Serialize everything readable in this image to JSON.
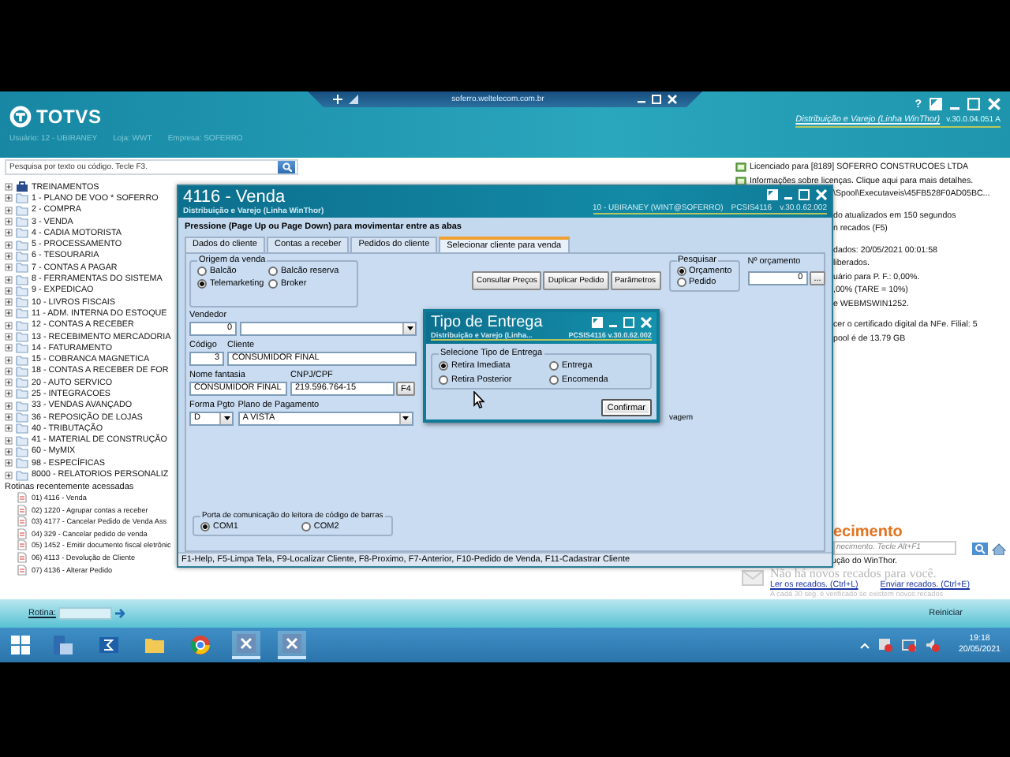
{
  "remote_bar": {
    "host": "soferro.weltelecom.com.br"
  },
  "app": {
    "logo": "TOTVS",
    "product": "Distribuição e Varejo (Linha WinThor)",
    "version": "v.30.0.04.051 A",
    "help": "?",
    "user_info": [
      "Usuário: 12 - UBIRANEY",
      "Loja: WWT",
      "Empresa: SOFERRO"
    ]
  },
  "search": {
    "placeholder": "Pesquisa por texto ou código. Tecle F3."
  },
  "tree": [
    {
      "label": "TREINAMENTOS",
      "kind": "root"
    },
    {
      "label": "1 - PLANO DE VOO   * SOFERRO",
      "kind": "folder"
    },
    {
      "label": "2 - COMPRA",
      "kind": "folder"
    },
    {
      "label": "3 - VENDA",
      "kind": "folder"
    },
    {
      "label": "4 - CADIA MOTORISTA",
      "kind": "folder"
    },
    {
      "label": "5 - PROCESSAMENTO",
      "kind": "folder"
    },
    {
      "label": "6 - TESOURARIA",
      "kind": "folder"
    },
    {
      "label": "7 - CONTAS A PAGAR",
      "kind": "folder"
    },
    {
      "label": "8 - FERRAMENTAS DO SISTEMA",
      "kind": "folder"
    },
    {
      "label": "9 - EXPEDICAO",
      "kind": "folder"
    },
    {
      "label": "10 - LIVROS FISCAIS",
      "kind": "folder"
    },
    {
      "label": "11 - ADM. INTERNA DO ESTOQUE",
      "kind": "folder"
    },
    {
      "label": "12 - CONTAS A RECEBER",
      "kind": "folder"
    },
    {
      "label": "13 - RECEBIMENTO MERCADORIA",
      "kind": "folder"
    },
    {
      "label": "14 - FATURAMENTO",
      "kind": "folder"
    },
    {
      "label": "15 - COBRANCA MAGNETICA",
      "kind": "folder"
    },
    {
      "label": "18 - CONTAS A RECEBER DE FOR",
      "kind": "folder"
    },
    {
      "label": "20 - AUTO SERVICO",
      "kind": "folder"
    },
    {
      "label": "25 - INTEGRACOES",
      "kind": "folder"
    },
    {
      "label": "33 - VENDAS AVANÇADO",
      "kind": "folder"
    },
    {
      "label": "36 - REPOSIÇÃO DE LOJAS",
      "kind": "folder"
    },
    {
      "label": "40 - TRIBUTAÇÃO",
      "kind": "folder"
    },
    {
      "label": "41 - MATERIAL DE CONSTRUÇÃO",
      "kind": "folder"
    },
    {
      "label": "60 - MyMIX",
      "kind": "folder"
    },
    {
      "label": "98 - ESPECÍFICAS",
      "kind": "folder"
    },
    {
      "label": "8000 - RELATORIOS PERSONALIZ",
      "kind": "folder"
    }
  ],
  "recent": {
    "title": "Rotinas recentemente acessadas",
    "items": [
      "01) 4116 - Venda",
      "02) 1220 - Agrupar contas a receber",
      "03) 4177 - Cancelar Pedido de Venda Ass",
      "04) 329 - Cancelar pedido de venda",
      "05) 1452 - Emitir documento fiscal eletrônic",
      "06) 4113 - Devolução de Cliente",
      "07) 4136 - Alterar Pedido"
    ]
  },
  "info_groups": [
    [
      {
        "text": "Licenciado para [8189] SOFERRO CONSTRUCOES LTDA",
        "kind": "notice"
      },
      {
        "text": "Informações sobre licenças. Clique aqui para mais detalhes.",
        "kind": "notice"
      },
      {
        "text": "\\Spool\\Executaveis\\45FB528F0AD05BC...",
        "kind": "cut"
      }
    ],
    [
      {
        "text": "do atualizados em 150 segundos",
        "kind": "cut"
      },
      {
        "text": "n recados (F5)",
        "kind": "cut"
      }
    ],
    [
      {
        "text": "dados: 20/05/2021 00:01:58",
        "kind": "cut"
      },
      {
        "text": "liberados.",
        "kind": "cut"
      },
      {
        "text": "uário para P. F.: 0,00%.",
        "kind": "cut"
      },
      {
        "text": ",00% (TARE = 10%)",
        "kind": "cut"
      },
      {
        "text": "e WEBMSWIN1252.",
        "kind": "cut"
      }
    ],
    [
      {
        "text": "cer o certificado digital da NFe. Filial: 5",
        "kind": "cut"
      },
      {
        "text": "pool é de 13.79 GB",
        "kind": "cut"
      }
    ]
  ],
  "knowledge": {
    "heading": "ecimento",
    "placeholder": "necimento. Tecle Alt+F1",
    "line": "ução do WinThor.",
    "no_messages": "Não há novos recados para você.",
    "links": [
      "Ler os recados. (Ctrl+L)",
      "Enviar recados. (Ctrl+E)"
    ],
    "note": "A cada 30 seg. é verificado se existem novos recados"
  },
  "bottom_bar": {
    "rotina_label": "Rotina:",
    "restart": "Reiniciar"
  },
  "venda": {
    "title": "4116 - Venda",
    "subtitle": "Distribuição e Varejo (Linha WinThor)",
    "user": "10 - UBIRANEY (WINT@SOFERRO)",
    "program": "PCSIS4116",
    "version": "v.30.0.62.002",
    "hint": "Pressione (Page Up ou Page Down) para movimentar entre as abas",
    "tabs": [
      {
        "label": "Dados do cliente",
        "selected": false
      },
      {
        "label": "Contas a receber",
        "selected": false
      },
      {
        "label": "Pedidos do cliente",
        "selected": false
      },
      {
        "label": "Selecionar cliente para venda",
        "selected": true
      }
    ],
    "origem": {
      "label": "Origem da venda",
      "options": [
        {
          "label": "Balcão",
          "selected": false
        },
        {
          "label": "Balcão reserva",
          "selected": false
        },
        {
          "label": "Telemarketing",
          "selected": true
        },
        {
          "label": "Broker",
          "selected": false
        }
      ]
    },
    "buttons": [
      "Consultar Preços",
      "Duplicar Pedido",
      "Parâmetros"
    ],
    "pesquisar": {
      "label": "Pesquisar",
      "options": [
        {
          "label": "Orçamento",
          "selected": true
        },
        {
          "label": "Pedido",
          "selected": false
        }
      ]
    },
    "orcamento": {
      "label": "Nº orçamento",
      "value": "0",
      "button": "..."
    },
    "vendedor": {
      "label": "Vendedor",
      "code": "0"
    },
    "codigo": {
      "label": "Código",
      "value": "3"
    },
    "cliente": {
      "label": "Cliente",
      "value": "CONSUMIDOR FINAL"
    },
    "fantasia": {
      "label": "Nome fantasia",
      "value": "CONSUMIDOR FINAL"
    },
    "cnpj": {
      "label": "CNPJ/CPF",
      "value": "219.596.764-15",
      "button": "F4"
    },
    "forma": {
      "label": "Forma Pgto",
      "value": "D"
    },
    "plano": {
      "label": "Plano de Pagamento",
      "value": "A VISTA"
    },
    "hidden_fragment": "vagem",
    "porta": {
      "label": "Porta de comunicação do leitora de código de barras",
      "options": [
        {
          "label": "COM1",
          "selected": true
        },
        {
          "label": "COM2",
          "selected": false
        }
      ]
    },
    "status": "F1-Help, F5-Limpa Tela, F9-Localizar Cliente, F8-Proximo, F7-Anterior, F10-Pedido de Venda, F11-Cadastrar Cliente"
  },
  "dialog": {
    "title": "Tipo de Entrega",
    "subtitle": "Distribuição e Varejo (Linha...",
    "program": "PCSIS4116  v.30.0.62.002",
    "group": "Selecione Tipo de Entrega",
    "options": [
      {
        "label": "Retira Imediata",
        "selected": true
      },
      {
        "label": "Entrega",
        "selected": false
      },
      {
        "label": "Retira Posterior",
        "selected": false
      },
      {
        "label": "Encomenda",
        "selected": false
      }
    ],
    "confirm": "Confirmar"
  },
  "taskbar": {
    "time": "19:18",
    "date": "20/05/2021"
  }
}
